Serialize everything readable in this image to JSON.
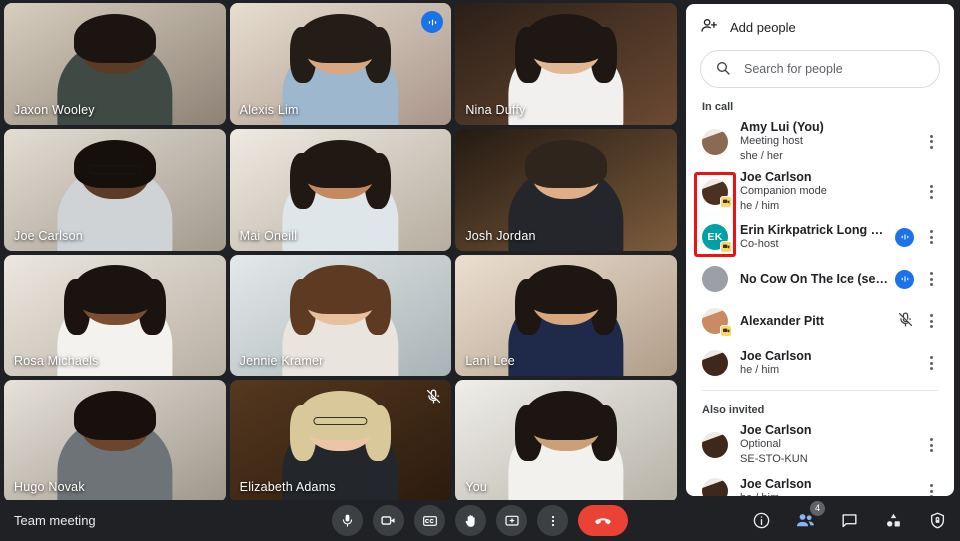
{
  "meeting": {
    "title": "Team meeting"
  },
  "grid": {
    "tiles": [
      {
        "name": "Jaxon Wooley",
        "active": false,
        "speaking": false,
        "muted": false,
        "skin": "#5a3b28",
        "hair": "#1b1410",
        "shirt": "#3f4a44",
        "bg1": "#d8cec0",
        "bg2": "#8d8275",
        "glasses": true,
        "hairstyle": "short"
      },
      {
        "name": "Alexis Lim",
        "active": true,
        "speaking": true,
        "muted": false,
        "skin": "#d9a882",
        "hair": "#241c16",
        "shirt": "#9db7cf",
        "bg1": "#e7ded0",
        "bg2": "#a9968a",
        "glasses": false,
        "hairstyle": "long"
      },
      {
        "name": "Nina Duffy",
        "active": false,
        "speaking": false,
        "muted": false,
        "skin": "#e0b894",
        "hair": "#1e1713",
        "shirt": "#f1f0ee",
        "bg1": "#2b1f18",
        "bg2": "#6b4a32",
        "glasses": false,
        "hairstyle": "long"
      },
      {
        "name": "Joe Carlson",
        "active": false,
        "speaking": false,
        "muted": false,
        "skin": "#5d3c27",
        "hair": "#16100c",
        "shirt": "#cfd3d6",
        "bg1": "#e3ddd4",
        "bg2": "#a39a8e",
        "glasses": true,
        "hairstyle": "short"
      },
      {
        "name": "Mai Oneill",
        "active": false,
        "speaking": false,
        "muted": false,
        "skin": "#c4895f",
        "hair": "#201812",
        "shirt": "#dfe6ea",
        "bg1": "#efeae2",
        "bg2": "#b7ada0",
        "glasses": false,
        "hairstyle": "long"
      },
      {
        "name": "Josh Jordan",
        "active": false,
        "speaking": false,
        "muted": false,
        "skin": "#dfae88",
        "hair": "#30251c",
        "shirt": "#24262b",
        "bg1": "#241a12",
        "bg2": "#7d5c3c",
        "glasses": false,
        "hairstyle": "short"
      },
      {
        "name": "Rosa Michaels",
        "active": false,
        "speaking": false,
        "muted": false,
        "skin": "#7b4e31",
        "hair": "#1a1310",
        "shirt": "#f4f2ef",
        "bg1": "#ece7df",
        "bg2": "#b9b0a4",
        "glasses": false,
        "hairstyle": "long"
      },
      {
        "name": "Jennie Kramer",
        "active": false,
        "speaking": false,
        "muted": false,
        "skin": "#e8c0a0",
        "hair": "#5e3a22",
        "shirt": "#e9e4dd",
        "bg1": "#e4e9ea",
        "bg2": "#a8b3b5",
        "glasses": false,
        "hairstyle": "long"
      },
      {
        "name": "Lani Lee",
        "active": false,
        "speaking": false,
        "muted": false,
        "skin": "#d9a77e",
        "hair": "#1d1612",
        "shirt": "#1f2a4a",
        "bg1": "#ecdfd0",
        "bg2": "#b09d89",
        "glasses": false,
        "hairstyle": "long"
      },
      {
        "name": "Hugo Novak",
        "active": false,
        "speaking": false,
        "muted": false,
        "skin": "#6b452c",
        "hair": "#17100c",
        "shirt": "#6e7377",
        "bg1": "#e6e2da",
        "bg2": "#9e978b",
        "glasses": false,
        "hairstyle": "short"
      },
      {
        "name": "Elizabeth Adams",
        "active": false,
        "speaking": false,
        "muted": true,
        "skin": "#ecc5a6",
        "hair": "#d8c89a",
        "shirt": "#23262a",
        "bg1": "#55381f",
        "bg2": "#2b1b0e",
        "glasses": true,
        "hairstyle": "long"
      },
      {
        "name": "You",
        "active": false,
        "speaking": false,
        "muted": false,
        "skin": "#caa079",
        "hair": "#1c1512",
        "shirt": "#f3f1ee",
        "bg1": "#efeee9",
        "bg2": "#b6b2a7",
        "glasses": false,
        "hairstyle": "long"
      }
    ]
  },
  "panel": {
    "add_people_label": "Add people",
    "add_people_icon": "person-add-icon",
    "search": {
      "placeholder": "Search for people",
      "value": "",
      "icon": "search-icon"
    },
    "sections": [
      {
        "label": "In call",
        "participants": [
          {
            "name": "Amy Lui (You)",
            "sub1": "Meeting host",
            "sub2": "she / her",
            "avatar_type": "photo",
            "avatar_color": "#8a6a55",
            "initials": "",
            "companion_badge": false,
            "speaking": false,
            "muted": false
          },
          {
            "name": "Joe Carlson",
            "sub1": "Companion mode",
            "sub2": "he / him",
            "avatar_type": "photo",
            "avatar_color": "#4a3122",
            "initials": "",
            "companion_badge": true,
            "speaking": false,
            "muted": false
          },
          {
            "name": "Erin Kirkpatrick Long nam...",
            "sub1": "Co-host",
            "sub2": "",
            "avatar_type": "initials",
            "avatar_color": "#00a0a6",
            "initials": "EK",
            "companion_badge": true,
            "speaking": true,
            "muted": false
          },
          {
            "name": "No Cow On The Ice (se-sto..",
            "sub1": "",
            "sub2": "",
            "avatar_type": "blank",
            "avatar_color": "#9aa0a6",
            "initials": "",
            "companion_badge": false,
            "speaking": true,
            "muted": false
          },
          {
            "name": "Alexander Pitt",
            "sub1": "",
            "sub2": "",
            "avatar_type": "photo",
            "avatar_color": "#c98b63",
            "initials": "",
            "companion_badge": true,
            "speaking": false,
            "muted": true
          },
          {
            "name": "Joe Carlson",
            "sub1": "he / him",
            "sub2": "",
            "avatar_type": "photo",
            "avatar_color": "#3d281b",
            "initials": "",
            "companion_badge": false,
            "speaking": false,
            "muted": false
          }
        ]
      },
      {
        "label": "Also invited",
        "participants": [
          {
            "name": "Joe Carlson",
            "sub1": "Optional",
            "sub2": "SE-STO-KUN",
            "avatar_type": "photo",
            "avatar_color": "#3d281b",
            "initials": "",
            "companion_badge": false,
            "speaking": false,
            "muted": false
          },
          {
            "name": "Joe Carlson",
            "sub1": "he / him",
            "sub2": "",
            "avatar_type": "photo",
            "avatar_color": "#3d281b",
            "initials": "",
            "companion_badge": false,
            "speaking": false,
            "muted": false
          }
        ]
      }
    ],
    "highlight_color": "#ee1111"
  },
  "bottom_bar": {
    "center_controls": [
      {
        "name": "microphone-button",
        "icon": "microphone-icon"
      },
      {
        "name": "camera-button",
        "icon": "video-camera-icon"
      },
      {
        "name": "captions-button",
        "icon": "closed-captions-icon"
      },
      {
        "name": "raise-hand-button",
        "icon": "raised-hand-icon"
      },
      {
        "name": "present-button",
        "icon": "present-screen-icon"
      },
      {
        "name": "more-options-button",
        "icon": "more-vertical-icon"
      },
      {
        "name": "leave-call-button",
        "icon": "end-call-icon"
      }
    ],
    "right_controls": [
      {
        "name": "meeting-details-button",
        "icon": "info-icon",
        "badge": "",
        "active": false
      },
      {
        "name": "people-button",
        "icon": "people-icon",
        "badge": "4",
        "active": true
      },
      {
        "name": "chat-button",
        "icon": "chat-icon",
        "badge": "",
        "active": false
      },
      {
        "name": "activities-button",
        "icon": "activities-icon",
        "badge": "",
        "active": false
      },
      {
        "name": "host-controls-button",
        "icon": "shield-lock-icon",
        "badge": "",
        "active": false
      }
    ],
    "accent_active": "#8ab4f8",
    "hangup_color": "#ea4335"
  }
}
